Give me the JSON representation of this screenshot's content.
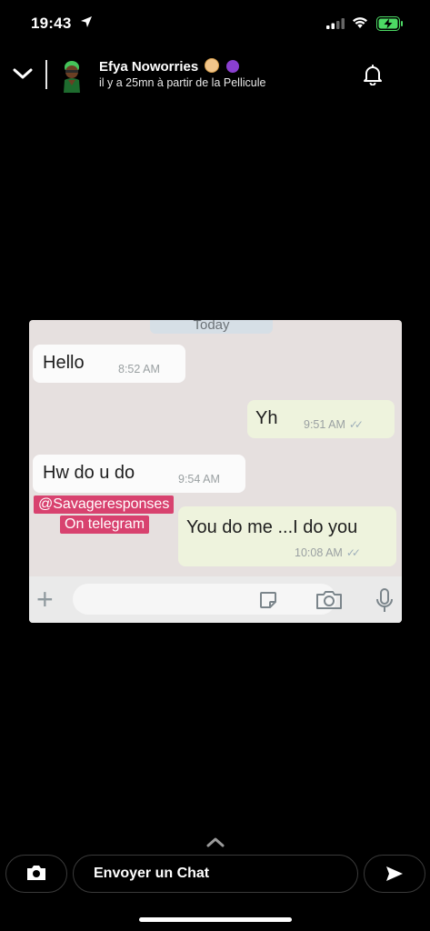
{
  "status_bar": {
    "time": "19:43"
  },
  "header": {
    "name": "Efya Noworries",
    "subtitle": "il y a 25mn à partir de la Pellicule"
  },
  "shared_image": {
    "date_label": "Today",
    "messages": [
      {
        "direction": "incoming",
        "text": "Hello",
        "time": "8:52 AM"
      },
      {
        "direction": "outgoing",
        "text": "Yh",
        "time": "9:51 AM"
      },
      {
        "direction": "incoming",
        "text": "Hw do u do",
        "time": "9:54 AM"
      },
      {
        "direction": "outgoing",
        "text": "You do me ...I do you",
        "time": "10:08 AM"
      }
    ],
    "watermark": {
      "line1": "@Savageresponses",
      "line2": "On telegram"
    }
  },
  "bottom_bar": {
    "chat_placeholder": "Envoyer un Chat"
  },
  "icons": {
    "back": "chevron-down-icon",
    "notification": "bell-icon",
    "camera": "camera-icon",
    "send": "send-arrow-icon",
    "swipe": "chevron-up-icon"
  },
  "colors": {
    "background": "#000000",
    "watermark": "#d8426f",
    "battery_charging": "#4cd964"
  }
}
